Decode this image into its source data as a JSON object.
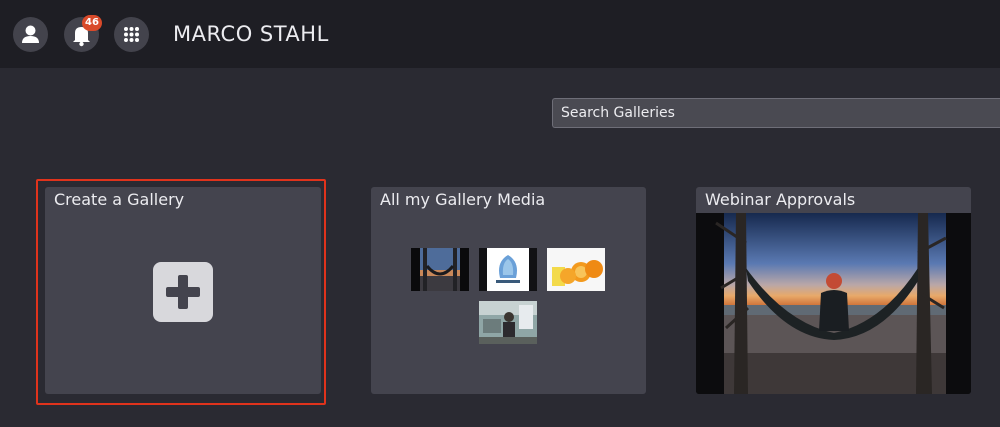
{
  "header": {
    "user_name": "MARCO STAHL",
    "notification_count": "46",
    "icons": [
      "profile-icon",
      "bell-icon",
      "apps-grid-icon"
    ]
  },
  "search": {
    "placeholder": "Search Galleries"
  },
  "galleries": [
    {
      "title": "Create a Gallery",
      "icon": "plus-icon"
    },
    {
      "title": "All my Gallery Media",
      "thumbnails": [
        "hammock-thumbnail",
        "projectus-logo-thumbnail",
        "oranges-thumbnail",
        "person-room-thumbnail"
      ]
    },
    {
      "title": "Webinar Approvals",
      "cover": "hammock-at-dusk-photo"
    }
  ],
  "colors": {
    "background": "#2a2a32",
    "topbar": "#1e1e24",
    "card": "#44444e",
    "badge": "#d94a2a",
    "selection": "#e0331c"
  }
}
